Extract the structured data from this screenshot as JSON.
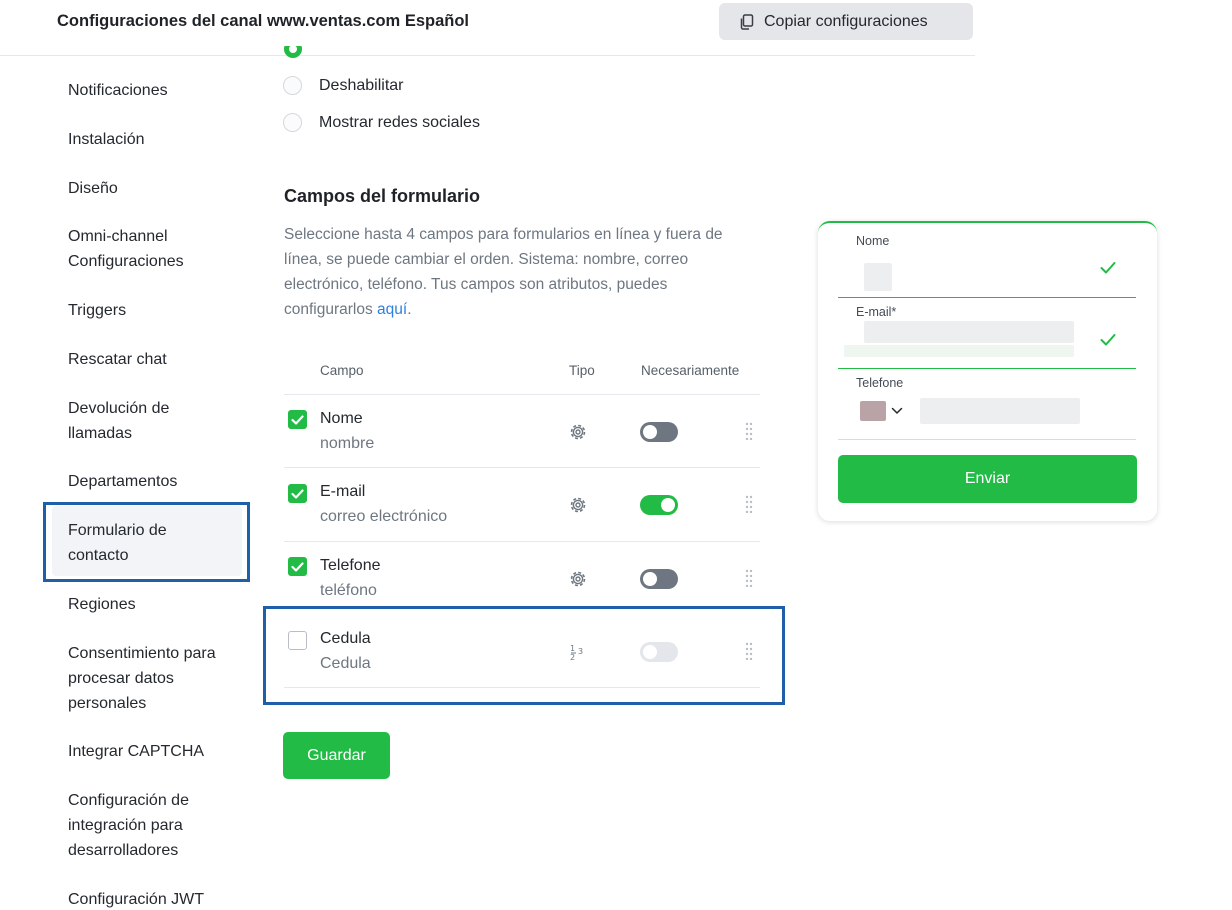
{
  "header": {
    "title": "Configuraciones del canal www.ventas.com Español",
    "copy_button": "Copiar configuraciones"
  },
  "sidebar": {
    "items": [
      {
        "label": "Notificaciones"
      },
      {
        "label": "Instalación"
      },
      {
        "label": "Diseño"
      },
      {
        "label": "Omni-channel Configuraciones"
      },
      {
        "label": "Triggers"
      },
      {
        "label": "Rescatar chat"
      },
      {
        "label": "Devolución de llamadas"
      },
      {
        "label": "Departamentos"
      },
      {
        "label": "Formulario de contacto"
      },
      {
        "label": "Regiones"
      },
      {
        "label": "Consentimiento para procesar datos personales"
      },
      {
        "label": "Integrar CAPTCHA"
      },
      {
        "label": "Configuración de integración para desarrolladores"
      },
      {
        "label": "Configuración JWT"
      }
    ],
    "active": "Formulario de contacto"
  },
  "display_options": {
    "options": [
      "Deshabilitar",
      "Mostrar redes sociales"
    ]
  },
  "form_fields": {
    "title": "Campos del formulario",
    "description": "Seleccione hasta 4 campos para formularios en línea y fuera de línea, se puede cambiar el orden. Sistema: nombre, correo electrónico, teléfono. Tus campos son atributos, puedes configurarlos ",
    "link": "aquí",
    "description_end": ".",
    "columns": {
      "field": "Campo",
      "type": "Tipo",
      "required": "Necesariamente"
    },
    "rows": [
      {
        "name": "Nome",
        "sub": "nombre",
        "checked": true,
        "type_icon": "gear-icon",
        "required": false
      },
      {
        "name": "E-mail",
        "sub": "correo electrónico",
        "checked": true,
        "type_icon": "gear-icon",
        "required": true
      },
      {
        "name": "Telefone",
        "sub": "teléfono",
        "checked": true,
        "type_icon": "gear-icon",
        "required": false
      },
      {
        "name": "Cedula",
        "sub": "Cedula",
        "checked": false,
        "type_icon": "number-type-icon",
        "required": false,
        "disabled": true
      }
    ],
    "save_button": "Guardar"
  },
  "preview": {
    "fields": [
      {
        "label": "Nome"
      },
      {
        "label": "E-mail*"
      },
      {
        "label": "Telefone"
      }
    ],
    "submit_button": "Enviar"
  },
  "colors": {
    "accent": "#22bb45",
    "highlight_box": "#1f5fa8",
    "link": "#2f7fe0"
  }
}
